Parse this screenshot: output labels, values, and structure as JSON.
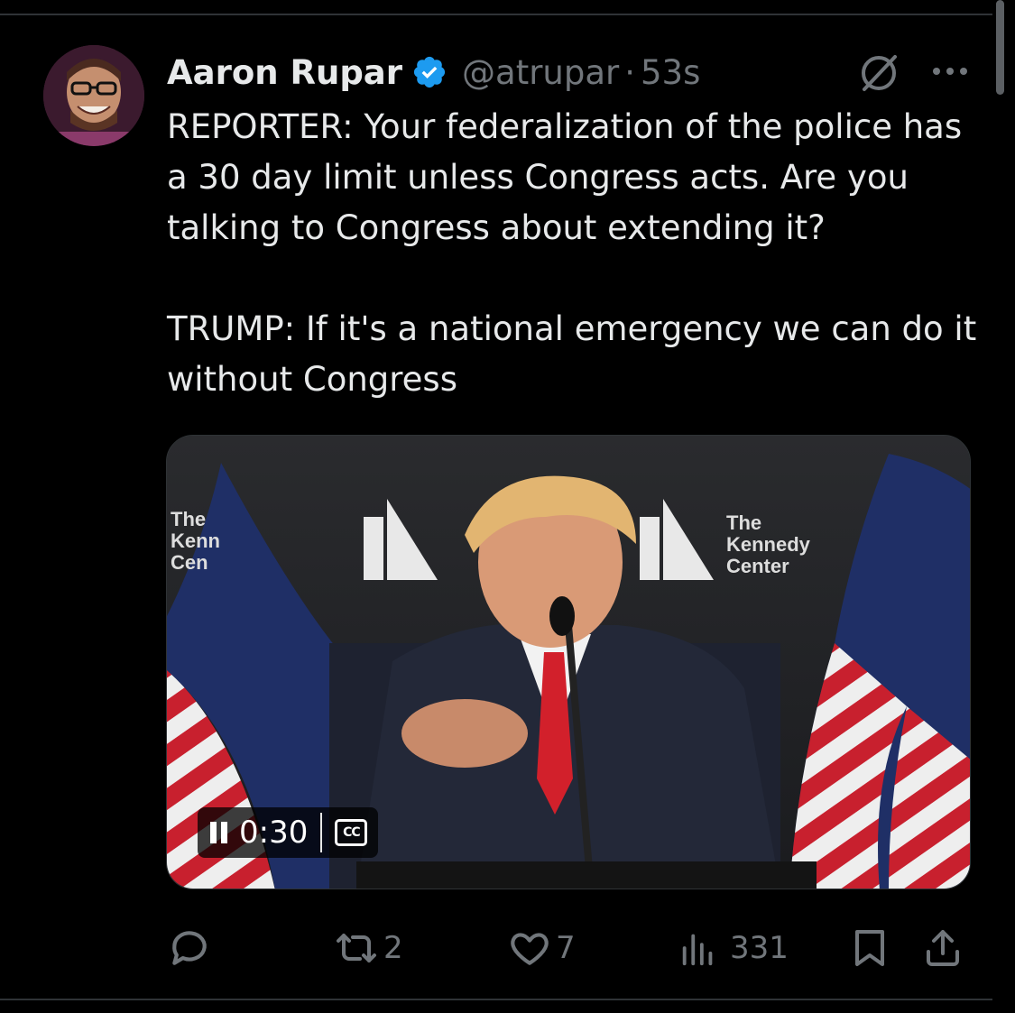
{
  "tweet": {
    "author": {
      "display_name": "Aaron Rupar",
      "handle": "@atrupar",
      "verified": true,
      "avatar_icon": "avatar"
    },
    "separator": "·",
    "timestamp": "53s",
    "paragraphs": [
      "REPORTER: Your federalization of the police has a 30 day limit unless Congress acts. Are you talking to Congress about extending it?",
      "TRUMP: If it's a national emergency we can do it without Congress"
    ],
    "media": {
      "type": "video",
      "elapsed": "0:30",
      "cc_label": "CC",
      "backdrop_text_left": [
        "The",
        "Kenn",
        "Cen"
      ],
      "backdrop_text_right": [
        "The",
        "Kennedy",
        "Center"
      ]
    },
    "actions": {
      "reply_count": "",
      "retweet_count": "2",
      "like_count": "7",
      "views_count": "331"
    }
  },
  "colors": {
    "background": "#000000",
    "text": "#e7e9ea",
    "muted": "#71767b",
    "verified_blue": "#1d9bf0",
    "divider": "#2f3336"
  },
  "icons": [
    "verified-badge-icon",
    "grok-icon",
    "more-icon",
    "pause-icon",
    "closed-captions-icon",
    "reply-icon",
    "retweet-icon",
    "like-icon",
    "views-icon",
    "bookmark-icon",
    "share-icon"
  ]
}
